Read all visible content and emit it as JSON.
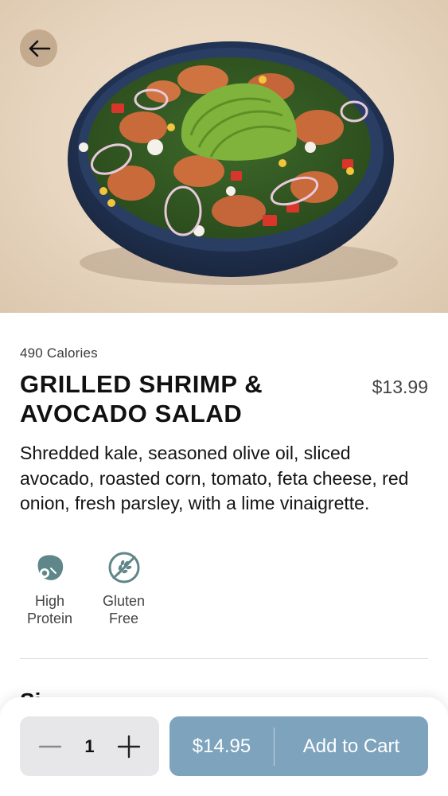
{
  "header": {
    "back_icon": "arrow-left-icon"
  },
  "hero": {
    "image": "grilled-shrimp-avocado-salad-bowl"
  },
  "item": {
    "calories": "490 Calories",
    "title": "GRILLED SHRIMP & AVOCADO SALAD",
    "price": "$13.99",
    "description": "Shredded kale, seasoned olive oil, sliced avocado, roasted corn, tomato, feta cheese, red onion, fresh parsley, with a lime vinaigrette.",
    "badges": [
      {
        "icon": "high-protein-icon",
        "line1": "High",
        "line2": "Protein"
      },
      {
        "icon": "gluten-free-icon",
        "line1": "Gluten",
        "line2": "Free"
      }
    ],
    "next_section_label": "Si"
  },
  "cart": {
    "quantity": "1",
    "total": "$14.95",
    "add_label": "Add to Cart",
    "accent": "#7ea3bd"
  }
}
